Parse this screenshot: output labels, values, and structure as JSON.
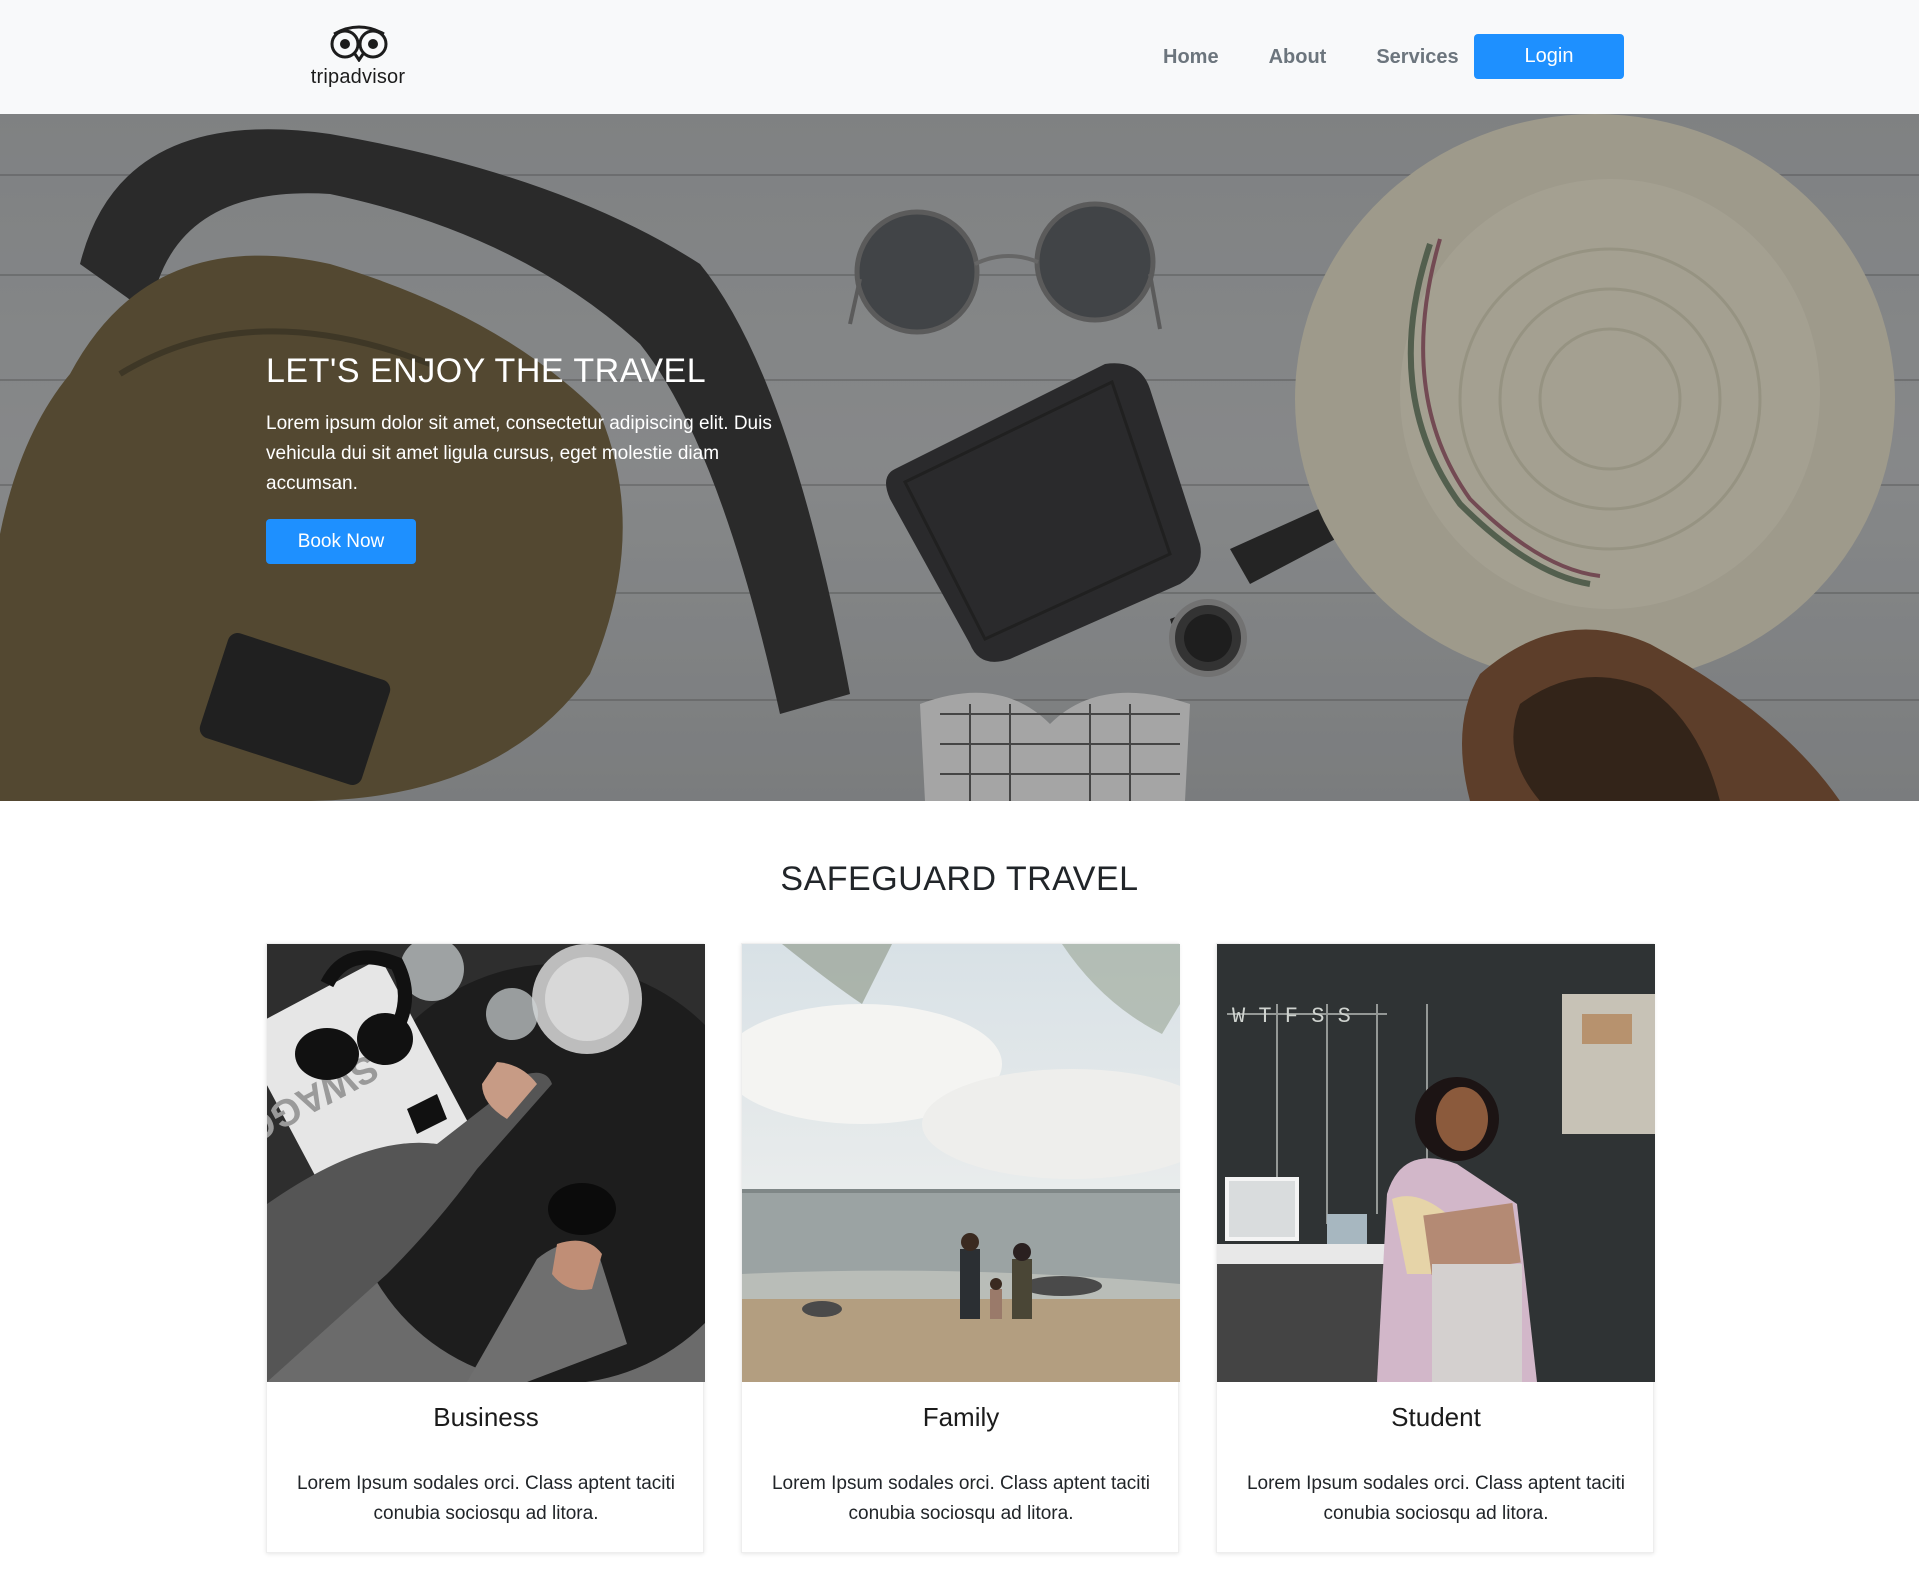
{
  "navbar": {
    "logo_text": "tripadvisor",
    "links": [
      "Home",
      "About",
      "Services"
    ],
    "login_label": "Login"
  },
  "hero": {
    "title": "LET'S ENJOY THE TRAVEL",
    "text": "Lorem ipsum dolor sit amet, consectetur adipiscing elit. Duis vehicula dui sit amet ligula cursus, eget molestie diam accumsan.",
    "button_label": "Book Now"
  },
  "section": {
    "title": "SAFEGUARD TRAVEL",
    "cards": [
      {
        "title": "Business",
        "text": "Lorem Ipsum sodales orci. Class aptent taciti conubia sociosqu ad litora."
      },
      {
        "title": "Family",
        "text": "Lorem Ipsum sodales orci. Class aptent taciti conubia sociosqu ad litora."
      },
      {
        "title": "Student",
        "text": "Lorem Ipsum sodales orci. Class aptent taciti conubia sociosqu ad litora."
      }
    ]
  },
  "colors": {
    "accent": "#1e90ff",
    "navbar_bg": "#f8f9fa",
    "nav_link": "#6c757d"
  },
  "icons": [
    "tripadvisor-owl-logo"
  ]
}
